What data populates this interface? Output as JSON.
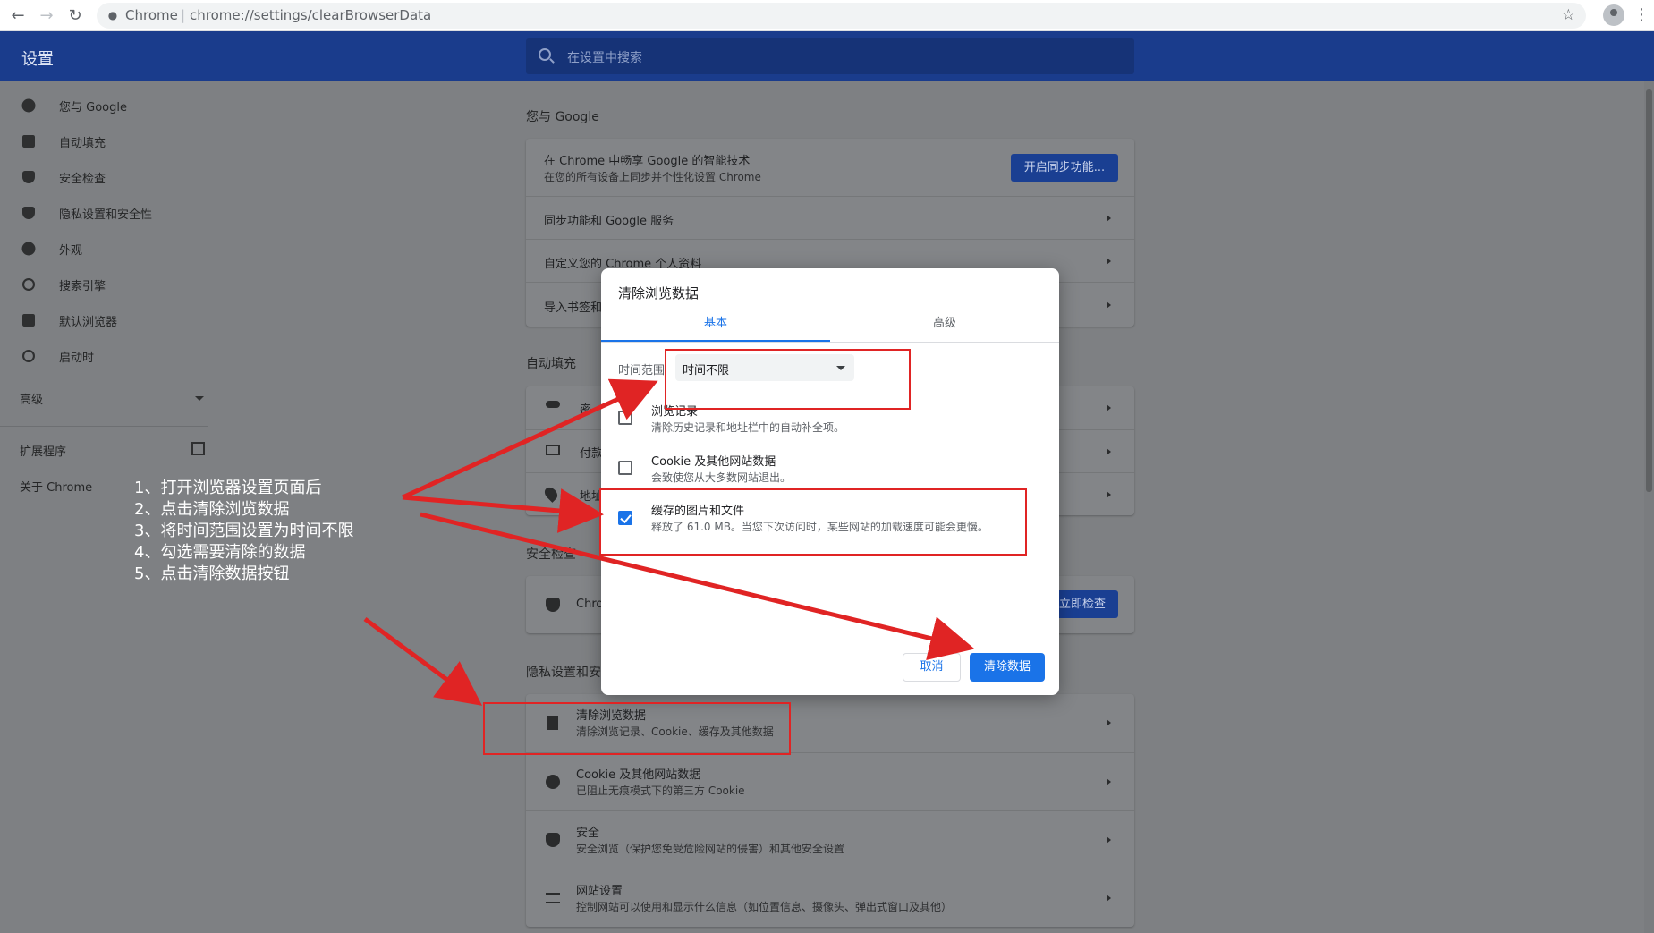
{
  "browser": {
    "site_label": "Chrome",
    "url": "chrome://settings/clearBrowserData",
    "separator": "|"
  },
  "header": {
    "title": "设置",
    "search_placeholder": "在设置中搜索"
  },
  "sidebar": {
    "items": [
      {
        "label": "您与 Google",
        "icon": "person-icon"
      },
      {
        "label": "自动填充",
        "icon": "clipboard-icon"
      },
      {
        "label": "安全检查",
        "icon": "shield-check-icon"
      },
      {
        "label": "隐私设置和安全性",
        "icon": "shield-icon"
      },
      {
        "label": "外观",
        "icon": "palette-icon"
      },
      {
        "label": "搜索引擎",
        "icon": "search-icon"
      },
      {
        "label": "默认浏览器",
        "icon": "browser-icon"
      },
      {
        "label": "启动时",
        "icon": "power-icon"
      }
    ],
    "advanced": "高级",
    "extensions": "扩展程序",
    "about": "关于 Chrome"
  },
  "main": {
    "you_google": {
      "title": "您与 Google",
      "promo_title": "在 Chrome 中畅享 Google 的智能技术",
      "promo_sub": "在您的所有设备上同步并个性化设置 Chrome",
      "sync_button": "开启同步功能...",
      "rows": [
        "同步功能和 Google 服务",
        "自定义您的 Chrome 个人资料",
        "导入书签和"
      ]
    },
    "autofill": {
      "title": "自动填充",
      "rows": [
        "密",
        "付款",
        "地址"
      ]
    },
    "safety": {
      "title": "安全检查",
      "row": "Chro",
      "button": "立即检查"
    },
    "privacy": {
      "title": "隐私设置和安",
      "rows": [
        {
          "title": "清除浏览数据",
          "sub": "清除浏览记录、Cookie、缓存及其他数据"
        },
        {
          "title": "Cookie 及其他网站数据",
          "sub": "已阻止无痕模式下的第三方 Cookie"
        },
        {
          "title": "安全",
          "sub": "安全浏览（保护您免受危险网站的侵害）和其他安全设置"
        },
        {
          "title": "网站设置",
          "sub": "控制网站可以使用和显示什么信息（如位置信息、摄像头、弹出式窗口及其他）"
        }
      ]
    }
  },
  "dialog": {
    "title": "清除浏览数据",
    "tabs": {
      "basic": "基本",
      "advanced": "高级"
    },
    "time_range_label": "时间范围",
    "time_range_value": "时间不限",
    "options": [
      {
        "title": "浏览记录",
        "sub": "清除历史记录和地址栏中的自动补全项。",
        "checked": false
      },
      {
        "title": "Cookie 及其他网站数据",
        "sub": "会致使您从大多数网站退出。",
        "checked": false
      },
      {
        "title": "缓存的图片和文件",
        "sub": "释放了 61.0 MB。当您下次访问时，某些网站的加载速度可能会更慢。",
        "checked": true
      }
    ],
    "cancel": "取消",
    "clear": "清除数据"
  },
  "instructions": [
    "1、打开浏览器设置页面后",
    "2、点击清除浏览数据",
    "3、将时间范围设置为时间不限",
    "4、勾选需要清除的数据",
    "5、点击清除数据按钮"
  ],
  "colors": {
    "accent": "#1a73e8",
    "header": "#1a3c8c",
    "annotation": "#e02424"
  }
}
